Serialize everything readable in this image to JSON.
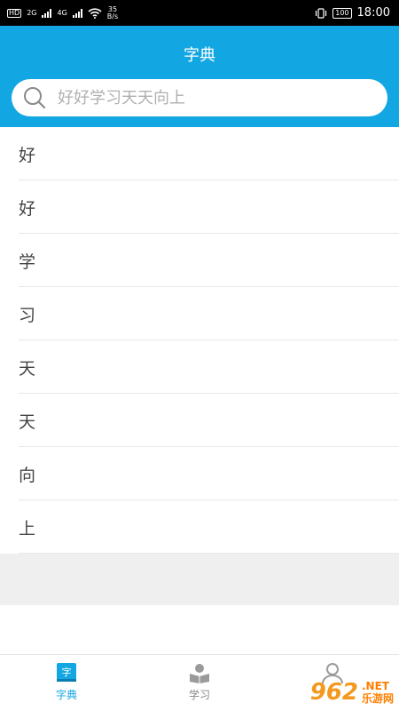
{
  "status_bar": {
    "hd": "HD",
    "net_type_1": "2G",
    "net_type_2": "4G",
    "speed_value": "35",
    "speed_unit": "B/s",
    "battery": "100",
    "time": "18:00"
  },
  "header": {
    "title": "字典"
  },
  "search": {
    "placeholder": "好好学习天天向上",
    "value": ""
  },
  "results": [
    "好",
    "好",
    "学",
    "习",
    "天",
    "天",
    "向",
    "上"
  ],
  "tabs": [
    {
      "label": "字典",
      "icon": "dictionary-icon",
      "active": true
    },
    {
      "label": "学习",
      "icon": "study-icon",
      "active": false
    },
    {
      "label": "",
      "icon": "profile-icon",
      "active": false
    }
  ],
  "colors": {
    "accent": "#12a6e2",
    "background": "#ffffff",
    "band": "#efefef"
  },
  "watermark": {
    "logo": "962",
    "suffix": ".NET",
    "text": "乐游网"
  }
}
